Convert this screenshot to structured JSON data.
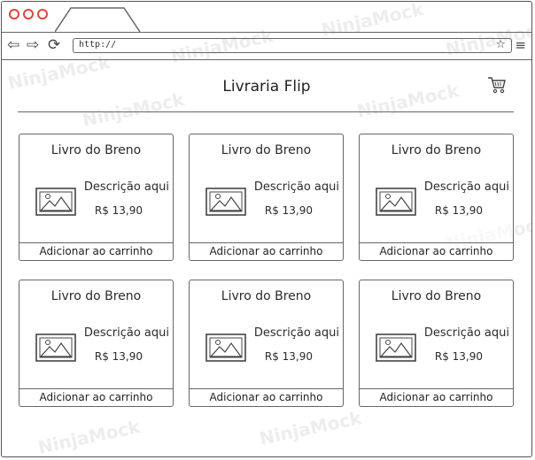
{
  "browser": {
    "url": "http://",
    "tab_label": ""
  },
  "header": {
    "title": "Livraria Flip"
  },
  "products": [
    {
      "title": "Livro do Breno",
      "description": "Descrição aqui",
      "price": "R$ 13,90",
      "button": "Adicionar ao carrinho"
    },
    {
      "title": "Livro do Breno",
      "description": "Descrição aqui",
      "price": "R$ 13,90",
      "button": "Adicionar ao carrinho"
    },
    {
      "title": "Livro do Breno",
      "description": "Descrição aqui",
      "price": "R$ 13,90",
      "button": "Adicionar ao carrinho"
    },
    {
      "title": "Livro do Breno",
      "description": "Descrição aqui",
      "price": "R$ 13,90",
      "button": "Adicionar ao carrinho"
    },
    {
      "title": "Livro do Breno",
      "description": "Descrição aqui",
      "price": "R$ 13,90",
      "button": "Adicionar ao carrinho"
    },
    {
      "title": "Livro do Breno",
      "description": "Descrição aqui",
      "price": "R$ 13,90",
      "button": "Adicionar ao carrinho"
    }
  ],
  "watermark": "NinjaMock",
  "icons": {
    "window_controls": [
      "close-dot-icon",
      "minimize-dot-icon",
      "maximize-dot-icon"
    ],
    "nav": [
      "back-arrow-icon",
      "forward-arrow-icon",
      "reload-icon"
    ],
    "bookmark": "star-icon",
    "menu": "hamburger-menu-icon",
    "cart": "shopping-cart-icon",
    "thumbnail": "image-placeholder-icon"
  },
  "colors": {
    "window_dots": "#e2433a",
    "stroke": "#666666",
    "text": "#2b2b2b",
    "watermark": "#ededed"
  }
}
